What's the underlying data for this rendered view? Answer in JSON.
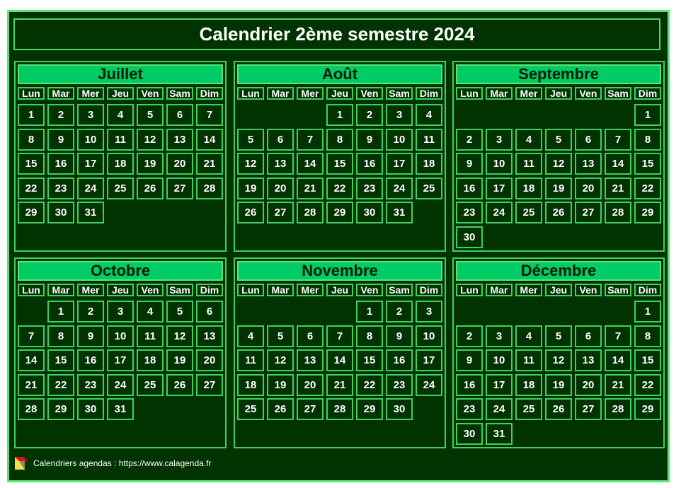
{
  "title": "Calendrier 2ème semestre 2024",
  "weekdays": [
    "Lun",
    "Mar",
    "Mer",
    "Jeu",
    "Ven",
    "Sam",
    "Dim"
  ],
  "months": [
    {
      "name": "Juillet",
      "offset": 0,
      "days": 31
    },
    {
      "name": "Août",
      "offset": 3,
      "days": 31
    },
    {
      "name": "Septembre",
      "offset": 6,
      "days": 30
    },
    {
      "name": "Octobre",
      "offset": 1,
      "days": 31
    },
    {
      "name": "Novembre",
      "offset": 4,
      "days": 30
    },
    {
      "name": "Décembre",
      "offset": 6,
      "days": 31
    }
  ],
  "footer": {
    "text": "Calendriers agendas : https://www.calagenda.fr",
    "icon": "calagenda-logo-icon"
  },
  "colors": {
    "background": "#003300",
    "accent": "#00cc66",
    "border": "#5be47a"
  }
}
